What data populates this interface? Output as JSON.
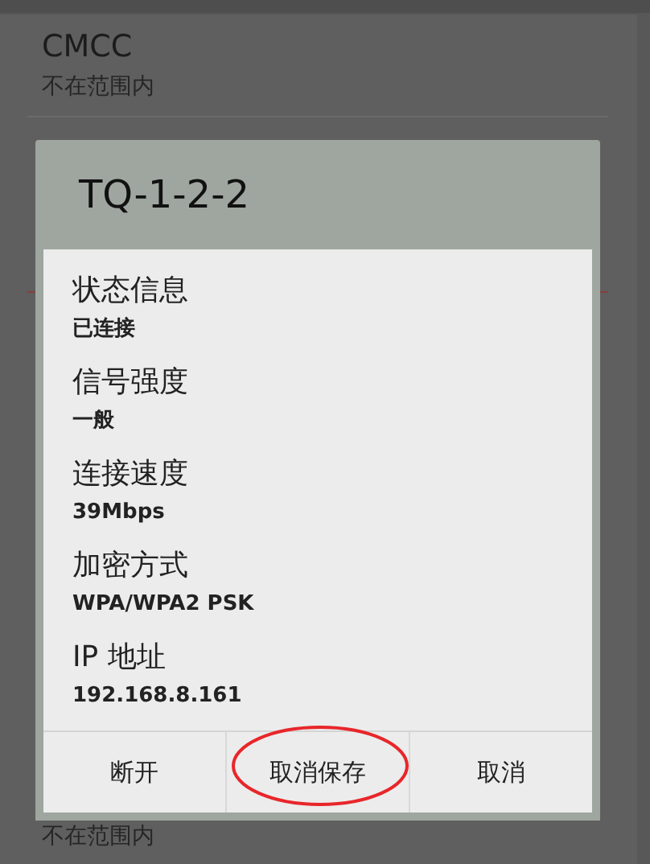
{
  "networks": [
    {
      "name": "CMCC",
      "status": "不在范围内"
    }
  ],
  "bottom_status": "不在范围内",
  "dialog": {
    "title": "TQ-1-2-2",
    "fields": [
      {
        "label": "状态信息",
        "value": "已连接"
      },
      {
        "label": "信号强度",
        "value": "一般"
      },
      {
        "label": "连接速度",
        "value": "39Mbps"
      },
      {
        "label": "加密方式",
        "value": "WPA/WPA2 PSK"
      },
      {
        "label": "IP 地址",
        "value": "192.168.8.161"
      }
    ],
    "buttons": [
      {
        "label": "断开",
        "highlighted": false
      },
      {
        "label": "取消保存",
        "highlighted": true
      },
      {
        "label": "取消",
        "highlighted": false
      }
    ]
  }
}
